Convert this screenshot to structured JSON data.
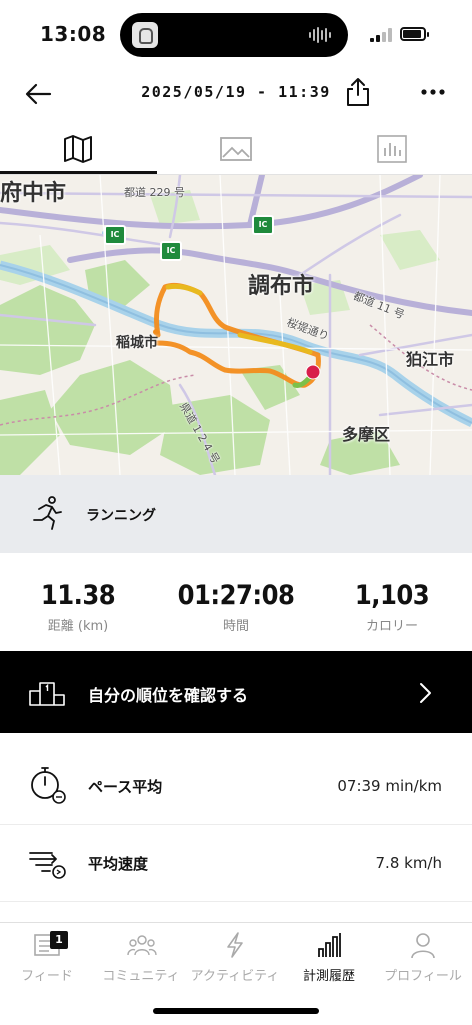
{
  "status_bar": {
    "time": "13:08",
    "battery_icon": "battery-icon",
    "signal_icon": "signal-icon"
  },
  "header": {
    "title": "2025/05/19 - 11:39"
  },
  "tabs": [
    {
      "name": "map",
      "icon": "map-icon",
      "active": true
    },
    {
      "name": "photos",
      "icon": "image-icon",
      "active": false
    },
    {
      "name": "stats",
      "icon": "chart-icon",
      "active": false
    }
  ],
  "map": {
    "labels": {
      "fuchu": "府中市",
      "chofu": "調布市",
      "inagi": "稲城市",
      "komae": "狛江市",
      "tama": "多摩区",
      "road229": "都道 229 号",
      "road11": "都道 11 号",
      "sakura": "桜堤通り",
      "road124": "県道 1 2 4 号",
      "ic": "IC"
    },
    "route_color": "#f28c1c",
    "end_marker_color": "#d81e4b"
  },
  "activity": {
    "label": "ランニング"
  },
  "stats": {
    "distance": {
      "value": "11.38",
      "label": "距離 (km)"
    },
    "time": {
      "value": "01:27:08",
      "label": "時間"
    },
    "calories": {
      "value": "1,103",
      "label": "カロリー"
    }
  },
  "rank": {
    "label": "自分の順位を確認する"
  },
  "metrics": [
    {
      "label": "ペース平均",
      "value": "07:39 min/km",
      "icon": "pace-stopwatch-icon"
    },
    {
      "label": "平均速度",
      "value": "7.8 km/h",
      "icon": "speed-icon"
    }
  ],
  "bottom_nav": {
    "feed": {
      "label": "フィード",
      "badge": "1"
    },
    "community": {
      "label": "コミュニティ"
    },
    "activity": {
      "label": "アクティビティ"
    },
    "history": {
      "label": "計測履歴"
    },
    "profile": {
      "label": "プロフィール"
    }
  }
}
